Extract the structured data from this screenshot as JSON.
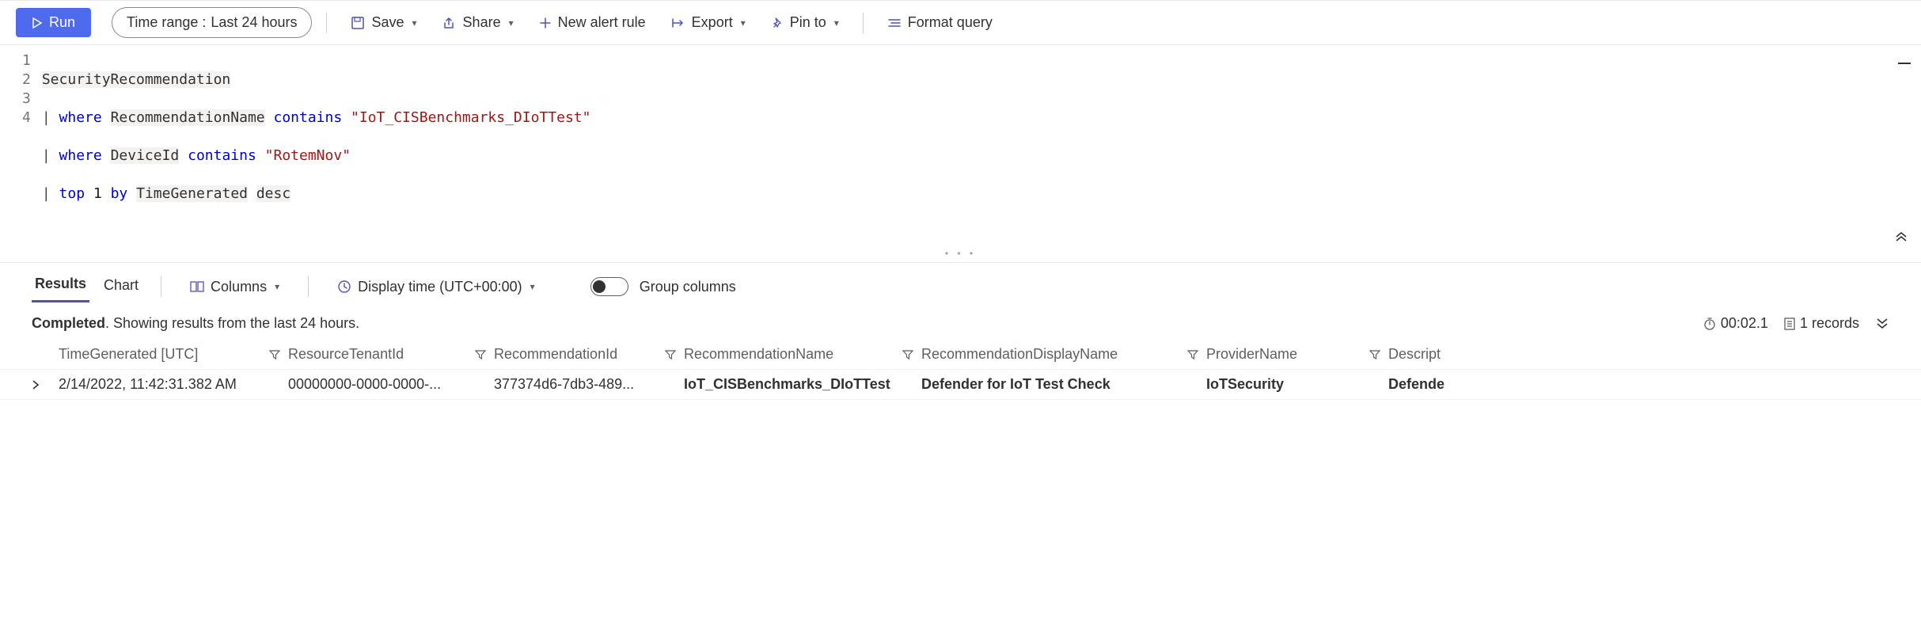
{
  "toolbar": {
    "run_label": "Run",
    "time_range_label": "Time range :",
    "time_range_value": "Last 24 hours",
    "save_label": "Save",
    "share_label": "Share",
    "new_alert_label": "New alert rule",
    "export_label": "Export",
    "pinto_label": "Pin to",
    "format_label": "Format query"
  },
  "editor": {
    "lines": [
      "1",
      "2",
      "3",
      "4"
    ],
    "l1": {
      "id": "SecurityRecommendation"
    },
    "l2": {
      "pipe": "|",
      "kw": "where",
      "field": "RecommendationName",
      "op": "contains",
      "str": "\"IoT_CISBenchmarks_DIoTTest\""
    },
    "l3": {
      "pipe": "|",
      "kw": "where",
      "field": "DeviceId",
      "op": "contains",
      "str": "\"RotemNov\""
    },
    "l4": {
      "pipe": "|",
      "kw1": "top",
      "num": "1",
      "kw2": "by",
      "field": "TimeGenerated",
      "dir": "desc"
    }
  },
  "results_tabs": {
    "results": "Results",
    "chart": "Chart",
    "columns": "Columns",
    "display_time": "Display time (UTC+00:00)",
    "group_columns": "Group columns"
  },
  "status": {
    "completed": "Completed",
    "detail": ". Showing results from the last 24 hours.",
    "duration": "00:02.1",
    "records": "1 records"
  },
  "grid": {
    "headers": [
      "TimeGenerated [UTC]",
      "ResourceTenantId",
      "RecommendationId",
      "RecommendationName",
      "RecommendationDisplayName",
      "ProviderName",
      "Descript"
    ],
    "row0": {
      "c0": "2/14/2022, 11:42:31.382 AM",
      "c1": "00000000-0000-0000-...",
      "c2": "377374d6-7db3-489...",
      "c3": "IoT_CISBenchmarks_DIoTTest",
      "c4": "Defender for IoT Test Check",
      "c5": "IoTSecurity",
      "c6": "Defende"
    }
  }
}
